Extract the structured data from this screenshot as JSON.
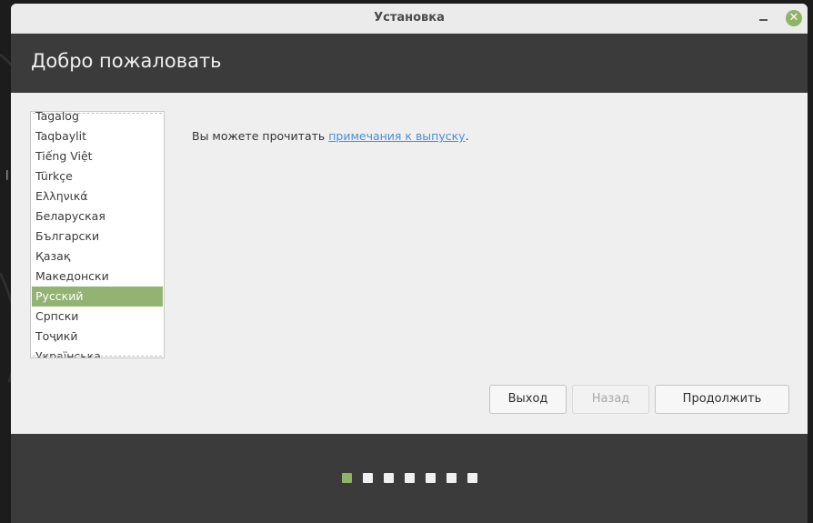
{
  "window": {
    "title": "Установка"
  },
  "header": {
    "title": "Добро пожаловать"
  },
  "languages": [
    {
      "label": "Tagalog",
      "selected": false
    },
    {
      "label": "Taqbaylit",
      "selected": false
    },
    {
      "label": "Tiếng Việt",
      "selected": false
    },
    {
      "label": "Türkçe",
      "selected": false
    },
    {
      "label": "Ελληνικά",
      "selected": false
    },
    {
      "label": "Беларуская",
      "selected": false
    },
    {
      "label": "Български",
      "selected": false
    },
    {
      "label": "Қазақ",
      "selected": false
    },
    {
      "label": "Македонски",
      "selected": false
    },
    {
      "label": "Русский",
      "selected": true
    },
    {
      "label": "Српски",
      "selected": false
    },
    {
      "label": "Тоҷикӣ",
      "selected": false
    },
    {
      "label": "Українська",
      "selected": false
    }
  ],
  "notes": {
    "prefix": "Вы можете прочитать ",
    "link": "примечания к выпуску",
    "suffix": "."
  },
  "buttons": {
    "quit": "Выход",
    "back": "Назад",
    "continue": "Продолжить"
  },
  "progress": {
    "total_steps": 7,
    "current_step": 1
  },
  "colors": {
    "accent": "#8fb468",
    "header_bg": "#3b3b3b",
    "link": "#4a8ed8"
  }
}
